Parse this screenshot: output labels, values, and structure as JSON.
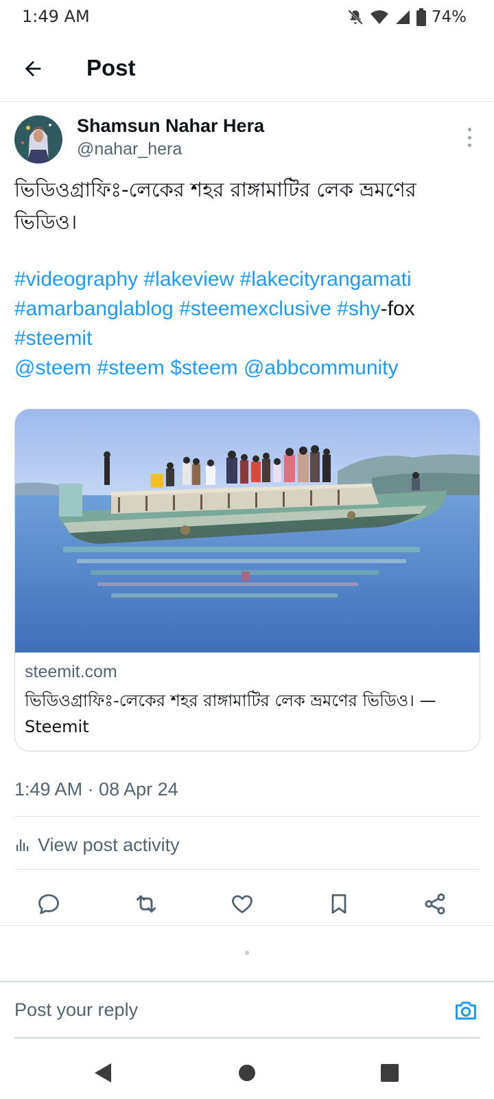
{
  "status_bar": {
    "time": "1:49 AM",
    "battery": "74%",
    "icons": [
      "bell-off-icon",
      "wifi-icon",
      "cellular-signal-icon",
      "battery-icon"
    ]
  },
  "header": {
    "title": "Post",
    "back_icon": "arrow-left-icon"
  },
  "post": {
    "author_name": "Shamsun Nahar Hera",
    "author_handle": "@nahar_hera",
    "text_line1": "ভিডিওগ্রাফিঃ-লেকের শহর রাঙ্গামাটির লেক ভ্রমণের",
    "text_line2": "ভিডিও।",
    "tags": {
      "t1": "#videography",
      "t2": "#lakeview",
      "t3": "#lakecityrangamati",
      "t4": "#amarbanglablog",
      "t5": "#steemexclusive",
      "t6": "#shy",
      "t6_suffix": "-fox",
      "t7": "#steemit",
      "t8": "@steem",
      "t9": "#steem",
      "t10": "$steem",
      "t11": "@abbcommunity"
    },
    "link_card": {
      "domain": "steemit.com",
      "title": "ভিডিওগ্রাফিঃ-লেকের শহর রাঙ্গামাটির লেক ভ্রমণের ভিডিও। — Steemit"
    },
    "timestamp": "1:49 AM · 08 Apr 24",
    "activity_label": "View post activity"
  },
  "actions": [
    "reply-icon",
    "repost-icon",
    "like-icon",
    "bookmark-icon",
    "share-icon"
  ],
  "reply": {
    "placeholder": "Post your reply"
  },
  "colors": {
    "link": "#1d9bf0",
    "secondary_text": "#536471",
    "primary_text": "#0f1419"
  }
}
